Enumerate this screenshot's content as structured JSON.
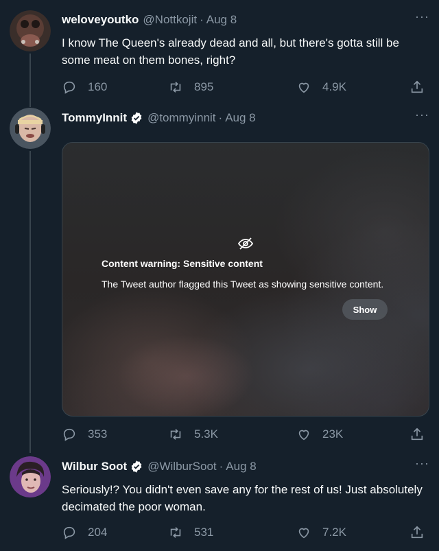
{
  "tweets": [
    {
      "name": "weloveyoutko",
      "handle": "@Nottkojit",
      "time": "Aug 8",
      "text": "I know The Queen's already dead and all, but there's gotta still be some meat on them bones, right?",
      "replies": "160",
      "retweets": "895",
      "likes": "4.9K"
    },
    {
      "name": "TommyInnit",
      "handle": "@tommyinnit",
      "time": "Aug 8",
      "verified": true,
      "media": {
        "warning_title": "Content warning: Sensitive content",
        "warning_text": "The Tweet author flagged this Tweet as showing sensitive content.",
        "show_label": "Show"
      },
      "replies": "353",
      "retweets": "5.3K",
      "likes": "23K"
    },
    {
      "name": "Wilbur Soot",
      "handle": "@WilburSoot",
      "time": "Aug 8",
      "verified": true,
      "text": "Seriously!? You didn't even save any for the rest of us! Just absolutely decimated the poor woman.",
      "replies": "204",
      "retweets": "531",
      "likes": "7.2K"
    }
  ],
  "more_glyph": "···",
  "dot": "·",
  "colors": {
    "background": "#15202b",
    "text_primary": "#f7f9f9",
    "text_secondary": "#8b98a5",
    "verified_badge": "#ffffff",
    "thread_line": "#38444d"
  },
  "icons": [
    "reply-icon",
    "retweet-icon",
    "like-icon",
    "share-icon",
    "verified-icon",
    "more-icon",
    "eye-off-icon"
  ]
}
